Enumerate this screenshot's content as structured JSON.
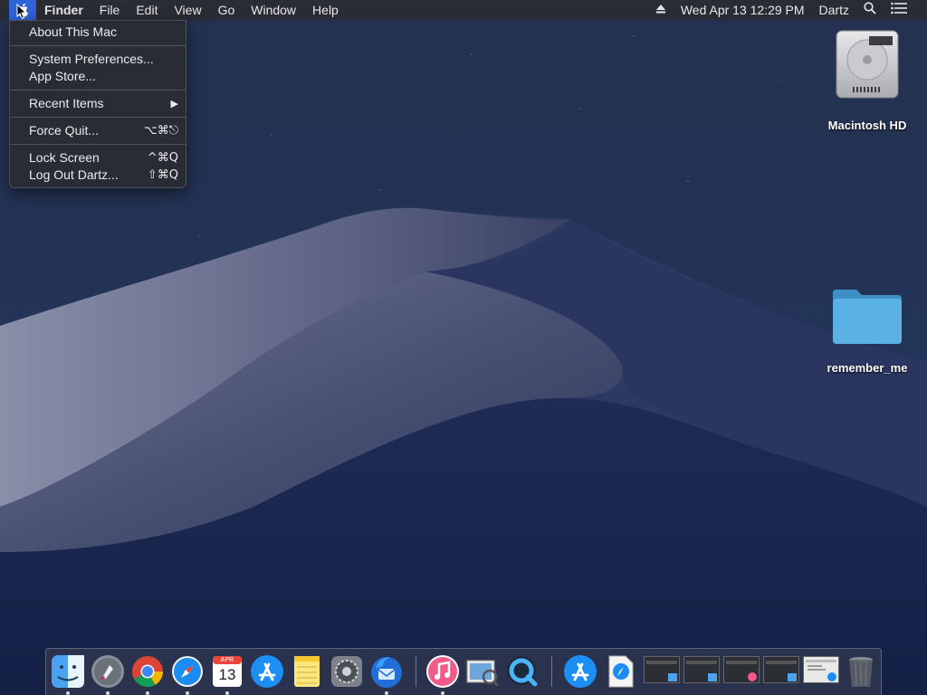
{
  "menubar": {
    "app_name": "Finder",
    "menus": [
      "File",
      "Edit",
      "View",
      "Go",
      "Window",
      "Help"
    ],
    "clock": "Wed Apr 13  12:29 PM",
    "user": "Dartz"
  },
  "apple_menu": {
    "about": "About This Mac",
    "system_preferences": "System Preferences...",
    "app_store": "App Store...",
    "recent_items": "Recent Items",
    "force_quit": "Force Quit...",
    "force_quit_shortcut": "⌥⌘⎋",
    "lock_screen": "Lock Screen",
    "lock_screen_shortcut": "^⌘Q",
    "log_out": "Log Out Dartz...",
    "log_out_shortcut": "⇧⌘Q"
  },
  "desktop": {
    "hd_label": "Macintosh HD",
    "folder_label": "remember_me"
  },
  "dock": {
    "calendar_month": "APR",
    "calendar_day": "13"
  },
  "colors": {
    "menubar": "#2a2c34",
    "highlight": "#2f63d6",
    "folder": "#4fa6de"
  }
}
